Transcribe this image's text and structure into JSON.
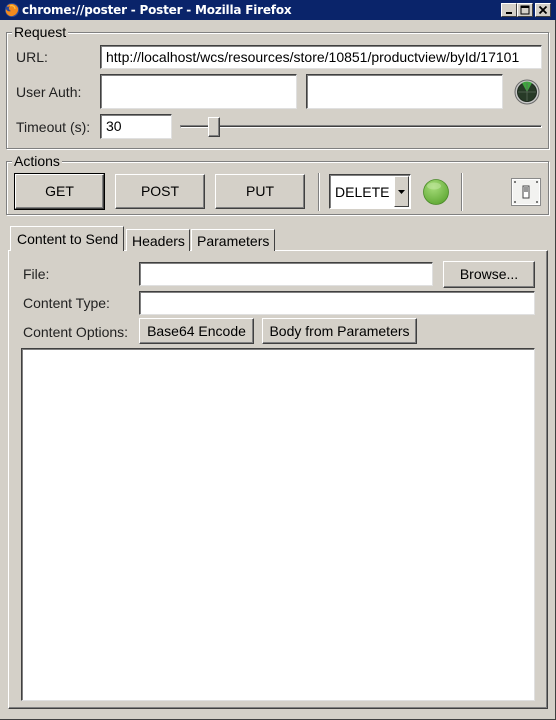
{
  "window": {
    "title": "chrome://poster - Poster - Mozilla Firefox",
    "icons": {
      "app": "firefox-icon",
      "minimize": "minimize-icon",
      "maximize": "maximize-icon",
      "close": "close-icon"
    }
  },
  "request": {
    "group_label": "Request",
    "url_label": "URL:",
    "url_value": "http://localhost/wcs/resources/store/10851/productview/byId/17101",
    "user_auth_label": "User Auth:",
    "user_value": "",
    "password_value": "",
    "auth_icon": "auth-radar-icon",
    "timeout_label": "Timeout (s):",
    "timeout_value": "30",
    "timeout_slider_fraction": 0.08
  },
  "actions": {
    "group_label": "Actions",
    "buttons": [
      "GET",
      "POST",
      "PUT"
    ],
    "method_select_value": "DELETE",
    "status_icon": "status-green-light-icon",
    "status_color": "#7cc04c",
    "toggle_icon": "light-switch-icon"
  },
  "tabs": {
    "items": [
      "Content to Send",
      "Headers",
      "Parameters"
    ],
    "active": "Content to Send"
  },
  "content": {
    "file_label": "File:",
    "file_value": "",
    "browse_label": "Browse...",
    "content_type_label": "Content Type:",
    "content_type_value": "",
    "options_label": "Content Options:",
    "base64_label": "Base64 Encode",
    "body_from_params_label": "Body from Parameters",
    "body_value": ""
  }
}
